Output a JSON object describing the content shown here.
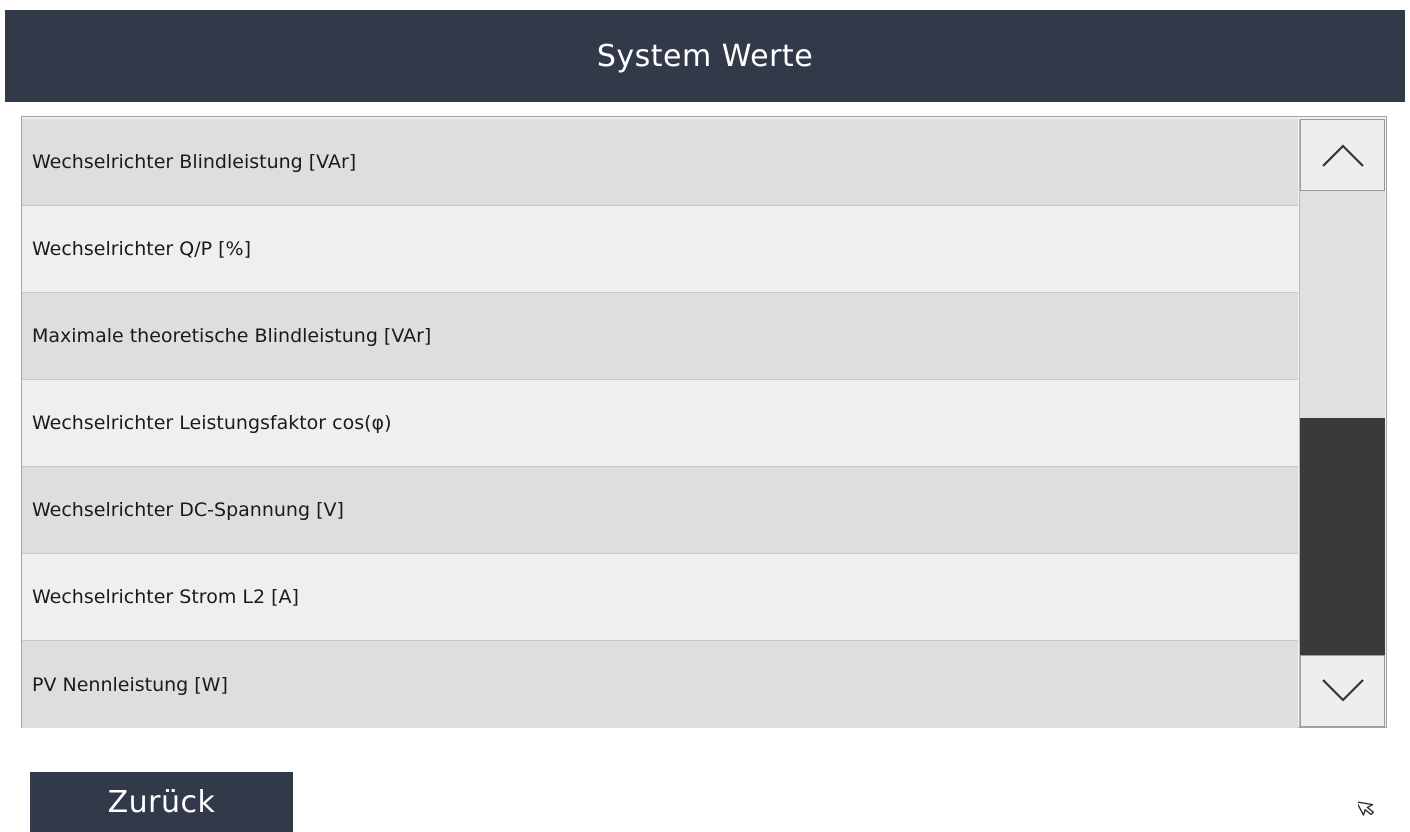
{
  "header": {
    "title": "System Werte"
  },
  "list": {
    "items": [
      {
        "label": "Wechselrichter Blindleistung [VAr]"
      },
      {
        "label": "Wechselrichter Q/P [%]"
      },
      {
        "label": "Maximale theoretische Blindleistung [VAr]"
      },
      {
        "label": "Wechselrichter Leistungsfaktor cos(φ)"
      },
      {
        "label": "Wechselrichter DC-Spannung [V]"
      },
      {
        "label": "Wechselrichter Strom L2 [A]"
      },
      {
        "label": "PV Nennleistung [W]"
      }
    ]
  },
  "scrollbar": {
    "up_icon": "chevron-up-icon",
    "down_icon": "chevron-down-icon",
    "thumb_start_fraction": 0.49,
    "thumb_end_fraction": 1.0
  },
  "footer": {
    "back_label": "Zurück"
  },
  "colors": {
    "header_bg": "#323a4a",
    "button_bg": "#323a4a",
    "row_odd": "#dedede",
    "row_even": "#efefef",
    "scroll_thumb": "#3a3a3a"
  }
}
